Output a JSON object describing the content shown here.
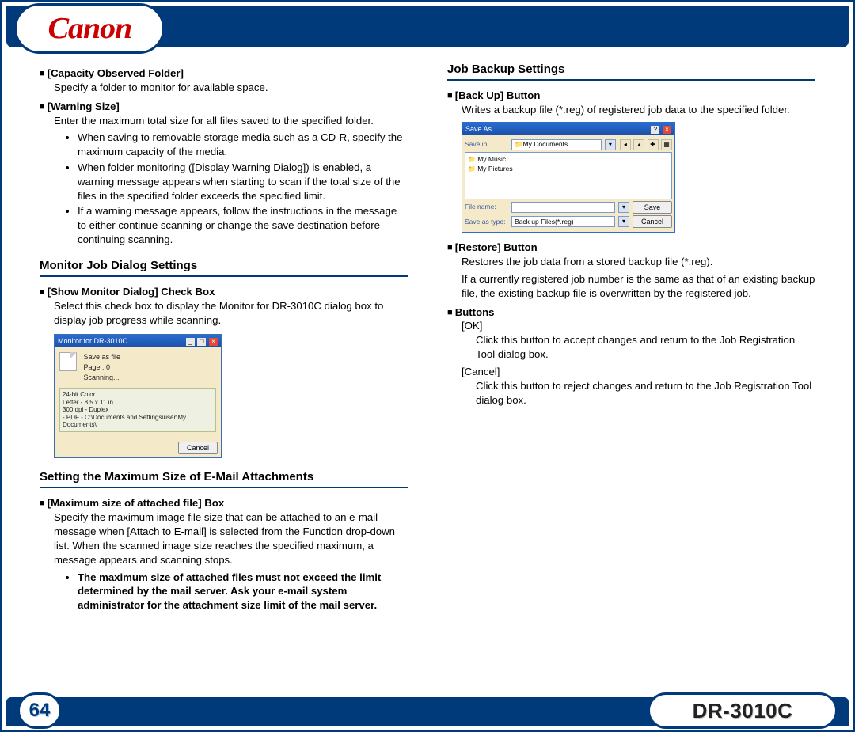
{
  "brand": "Canon",
  "page_number": "64",
  "model": "DR-3010C",
  "left": {
    "item1": {
      "head": "[Capacity Observed Folder]",
      "desc": "Specify a folder to monitor for available space."
    },
    "item2": {
      "head": "[Warning Size]",
      "desc": "Enter the maximum total size for all files saved to the specified folder.",
      "b1": "When saving to removable storage media such as a CD-R, specify the maximum capacity of the media.",
      "b2": "When folder monitoring ([Display Warning Dialog]) is enabled, a warning message appears when starting to scan if the total size of the files in the specified folder exceeds the specified limit.",
      "b3": "If a warning message appears, follow the instructions in the message to either continue scanning or change the save destination before continuing scanning."
    },
    "sec2_title": "Monitor Job Dialog Settings",
    "item3": {
      "head": "[Show Monitor Dialog] Check Box",
      "desc": "Select this check box to display the Monitor for DR-3010C dialog box to display job progress while scanning."
    },
    "monitor_dialog": {
      "title": "Monitor for DR-3010C",
      "l1": "Save as file",
      "l2": "Page :     0",
      "l3": "Scanning...",
      "d1": "24-bit Color",
      "d2": "Letter - 8.5 x 11 in",
      "d3": "300 dpi - Duplex",
      "d4": "- PDF - C:\\Documents and Settings\\user\\My Documents\\",
      "cancel": "Cancel"
    },
    "sec3_title": "Setting the Maximum Size of E-Mail Attachments",
    "item4": {
      "head": "[Maximum size of attached file] Box",
      "desc": "Specify the maximum image file size that can be attached to an e-mail message when [Attach to E-mail] is selected from the Function drop-down list. When the scanned image size reaches the specified maximum, a message appears and scanning stops.",
      "note": "The maximum size of attached files must not exceed the limit determined by the mail server. Ask your e-mail system administrator for the attachment size limit of the mail server."
    }
  },
  "right": {
    "sec_title": "Job Backup Settings",
    "item1": {
      "head": "[Back Up] Button",
      "desc": "Writes a backup file (*.reg) of registered job data to the specified folder."
    },
    "saveas": {
      "title": "Save As",
      "savein_lbl": "Save in:",
      "savein_val": "My Documents",
      "file1": "My Music",
      "file2": "My Pictures",
      "filename_lbl": "File name:",
      "filename_val": "",
      "type_lbl": "Save as type:",
      "type_val": "Back up Files(*.reg)",
      "save_btn": "Save",
      "cancel_btn": "Cancel"
    },
    "item2": {
      "head": "[Restore] Button",
      "desc1": "Restores the job data from a stored backup file (*.reg).",
      "desc2": "If a currently registered job number is the same as that of an existing backup file, the existing backup file is overwritten by the registered job."
    },
    "item3": {
      "head": "Buttons",
      "ok_lbl": "[OK]",
      "ok_desc": "Click this button to accept changes and return to the Job Registration Tool dialog box.",
      "cancel_lbl": "[Cancel]",
      "cancel_desc": "Click this button to reject changes and return to the Job Registration Tool dialog box."
    }
  }
}
